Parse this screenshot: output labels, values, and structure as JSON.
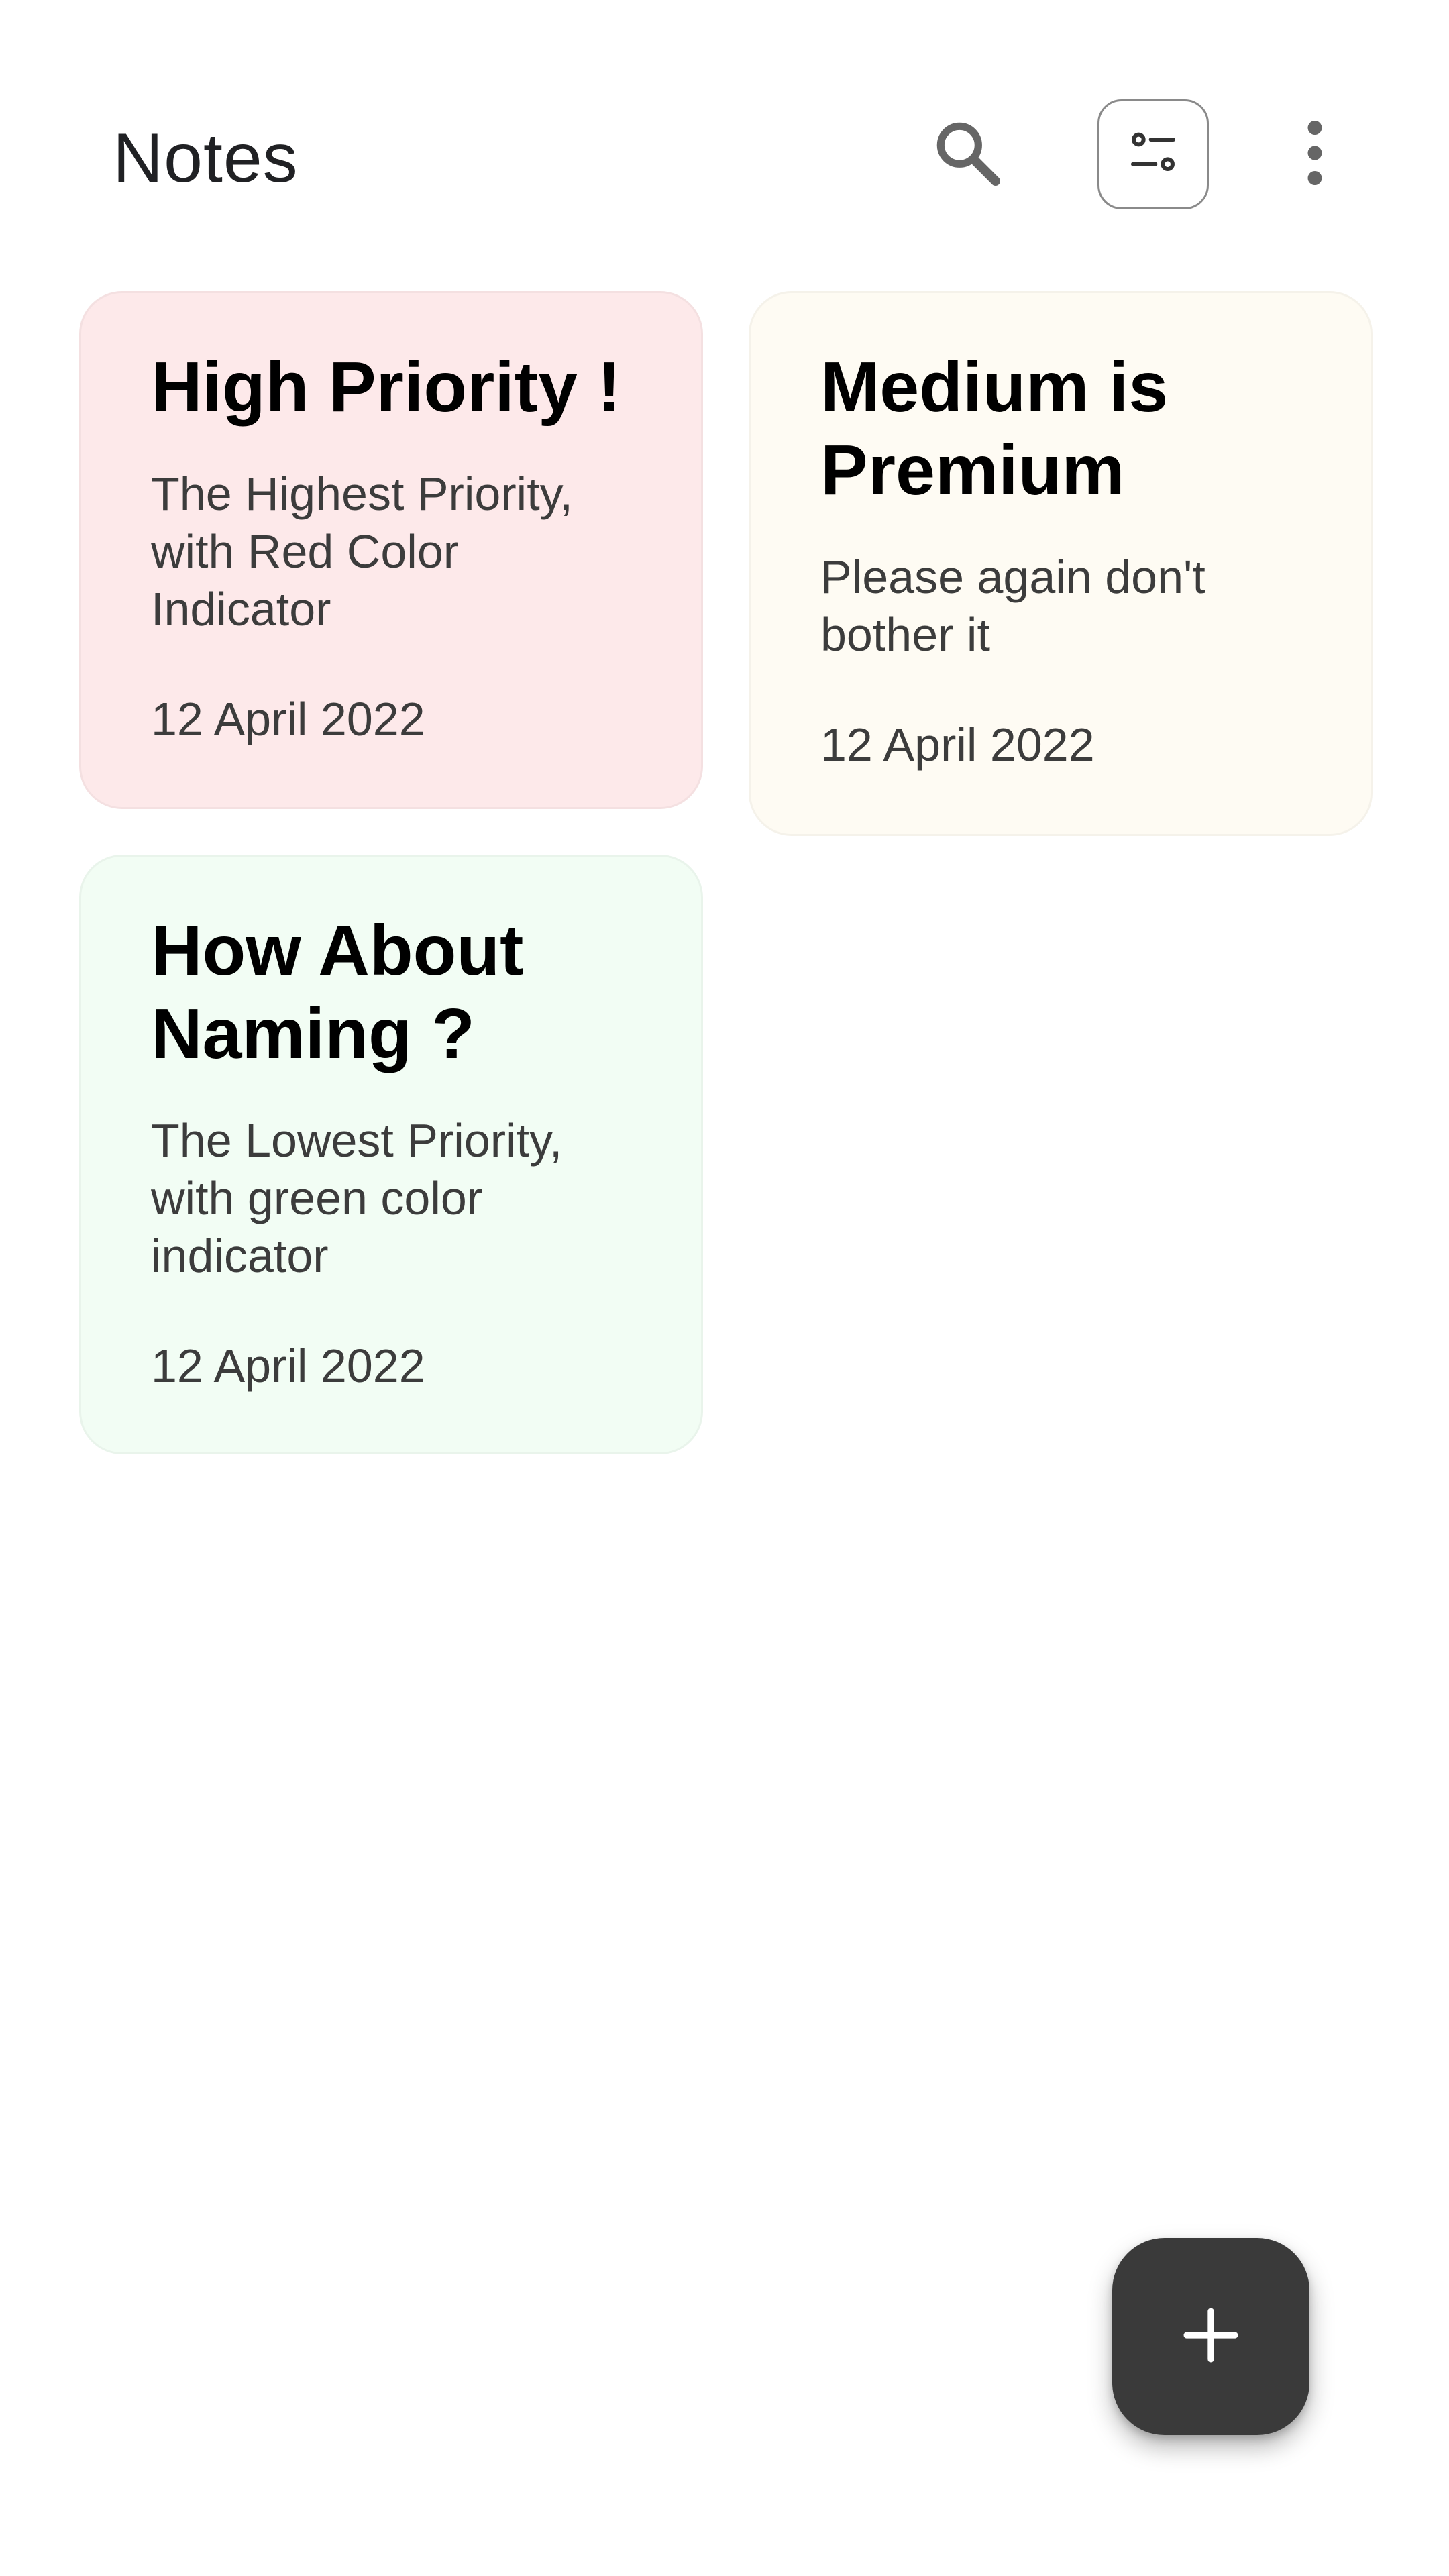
{
  "header": {
    "title": "Notes",
    "search_icon": "search-icon",
    "filter_icon": "filter-sort-icon",
    "more_icon": "more-vertical-icon"
  },
  "notes": [
    {
      "title": "High Priority !",
      "body": "The Highest Priority, with Red Color Indicator",
      "date": "12 April 2022",
      "priority": "high",
      "color": "#fde9ea"
    },
    {
      "title": "Medium is Premium",
      "body": "Please again don't bother it",
      "date": "12 April 2022",
      "priority": "medium",
      "color": "#fefbf3"
    },
    {
      "title": "How About Naming ?",
      "body": "The Lowest Priority, with green color indicator",
      "date": "12 April 2022",
      "priority": "low",
      "color": "#f2fdf4"
    }
  ],
  "fab": {
    "icon": "plus-icon"
  },
  "colors": {
    "background": "#ffffff",
    "fab": "#3a3a3a",
    "title_text": "#000000",
    "body_text": "#3c3c3c"
  }
}
